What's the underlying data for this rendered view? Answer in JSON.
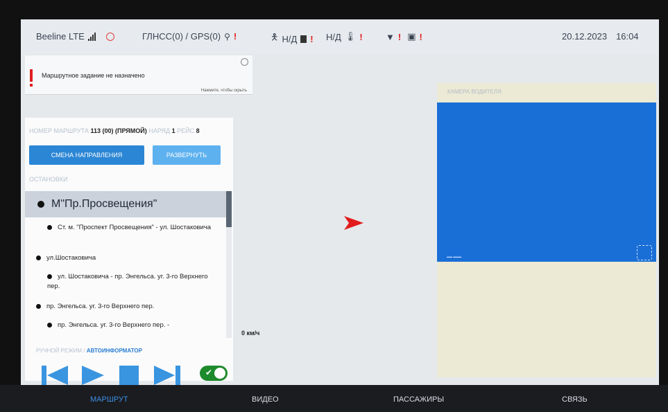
{
  "statusbar": {
    "network": "Beeline LTE",
    "gnss": "ГЛНСС(0) / GPS(0)",
    "passenger_na": "Н/Д",
    "sensor_na": "Н/Д",
    "date": "20.12.2023",
    "time": "16:04"
  },
  "alert": {
    "message": "Маршрутное задание не назначено",
    "hint": "Нажмите, чтобы скрыть"
  },
  "route": {
    "number_label": "НОМЕР МАРШРУТА",
    "number_value": "113 (00) (ПРЯМОЙ)",
    "order_label": "НАРЯД",
    "order_value": "1",
    "trip_label": "РЕЙС",
    "trip_value": "8",
    "change_direction_label": "СМЕНА НАПРАВЛЕНИЯ",
    "expand_label": "РАЗВЕРНУТЬ"
  },
  "stops": {
    "header": "ОСТАНОВКИ",
    "current": "М\"Пр.Просвещения\"",
    "items": [
      "Ст. м. \"Проспект Просвещения\" - ул. Шостаковича",
      "ул.Шостаковича",
      "ул. Шостаковича - пр. Энгельса. уг. 3-го Верхнего пер.",
      "пр. Энгельса. уг. 3-го Верхнего пер.",
      "пр. Энгельса. уг. 3-го Верхнего пер. -"
    ]
  },
  "mode": {
    "manual": "РУЧНОЙ РЕЖИМ /",
    "auto": "АВТОИНФОРМАТОР",
    "toggle_on": true
  },
  "speed": "0 км/ч",
  "camera": {
    "title": "КАМЕРА ВОДИТЕЛЯ"
  },
  "tabs": [
    "МАРШРУТ",
    "ВИДЕО",
    "ПАССАЖИРЫ",
    "СВЯЗЬ"
  ],
  "colors": {
    "accent": "#2b86d5",
    "warning": "#e02020",
    "camera_view": "#1a6fd6",
    "toggle_on": "#1d8a2c"
  }
}
